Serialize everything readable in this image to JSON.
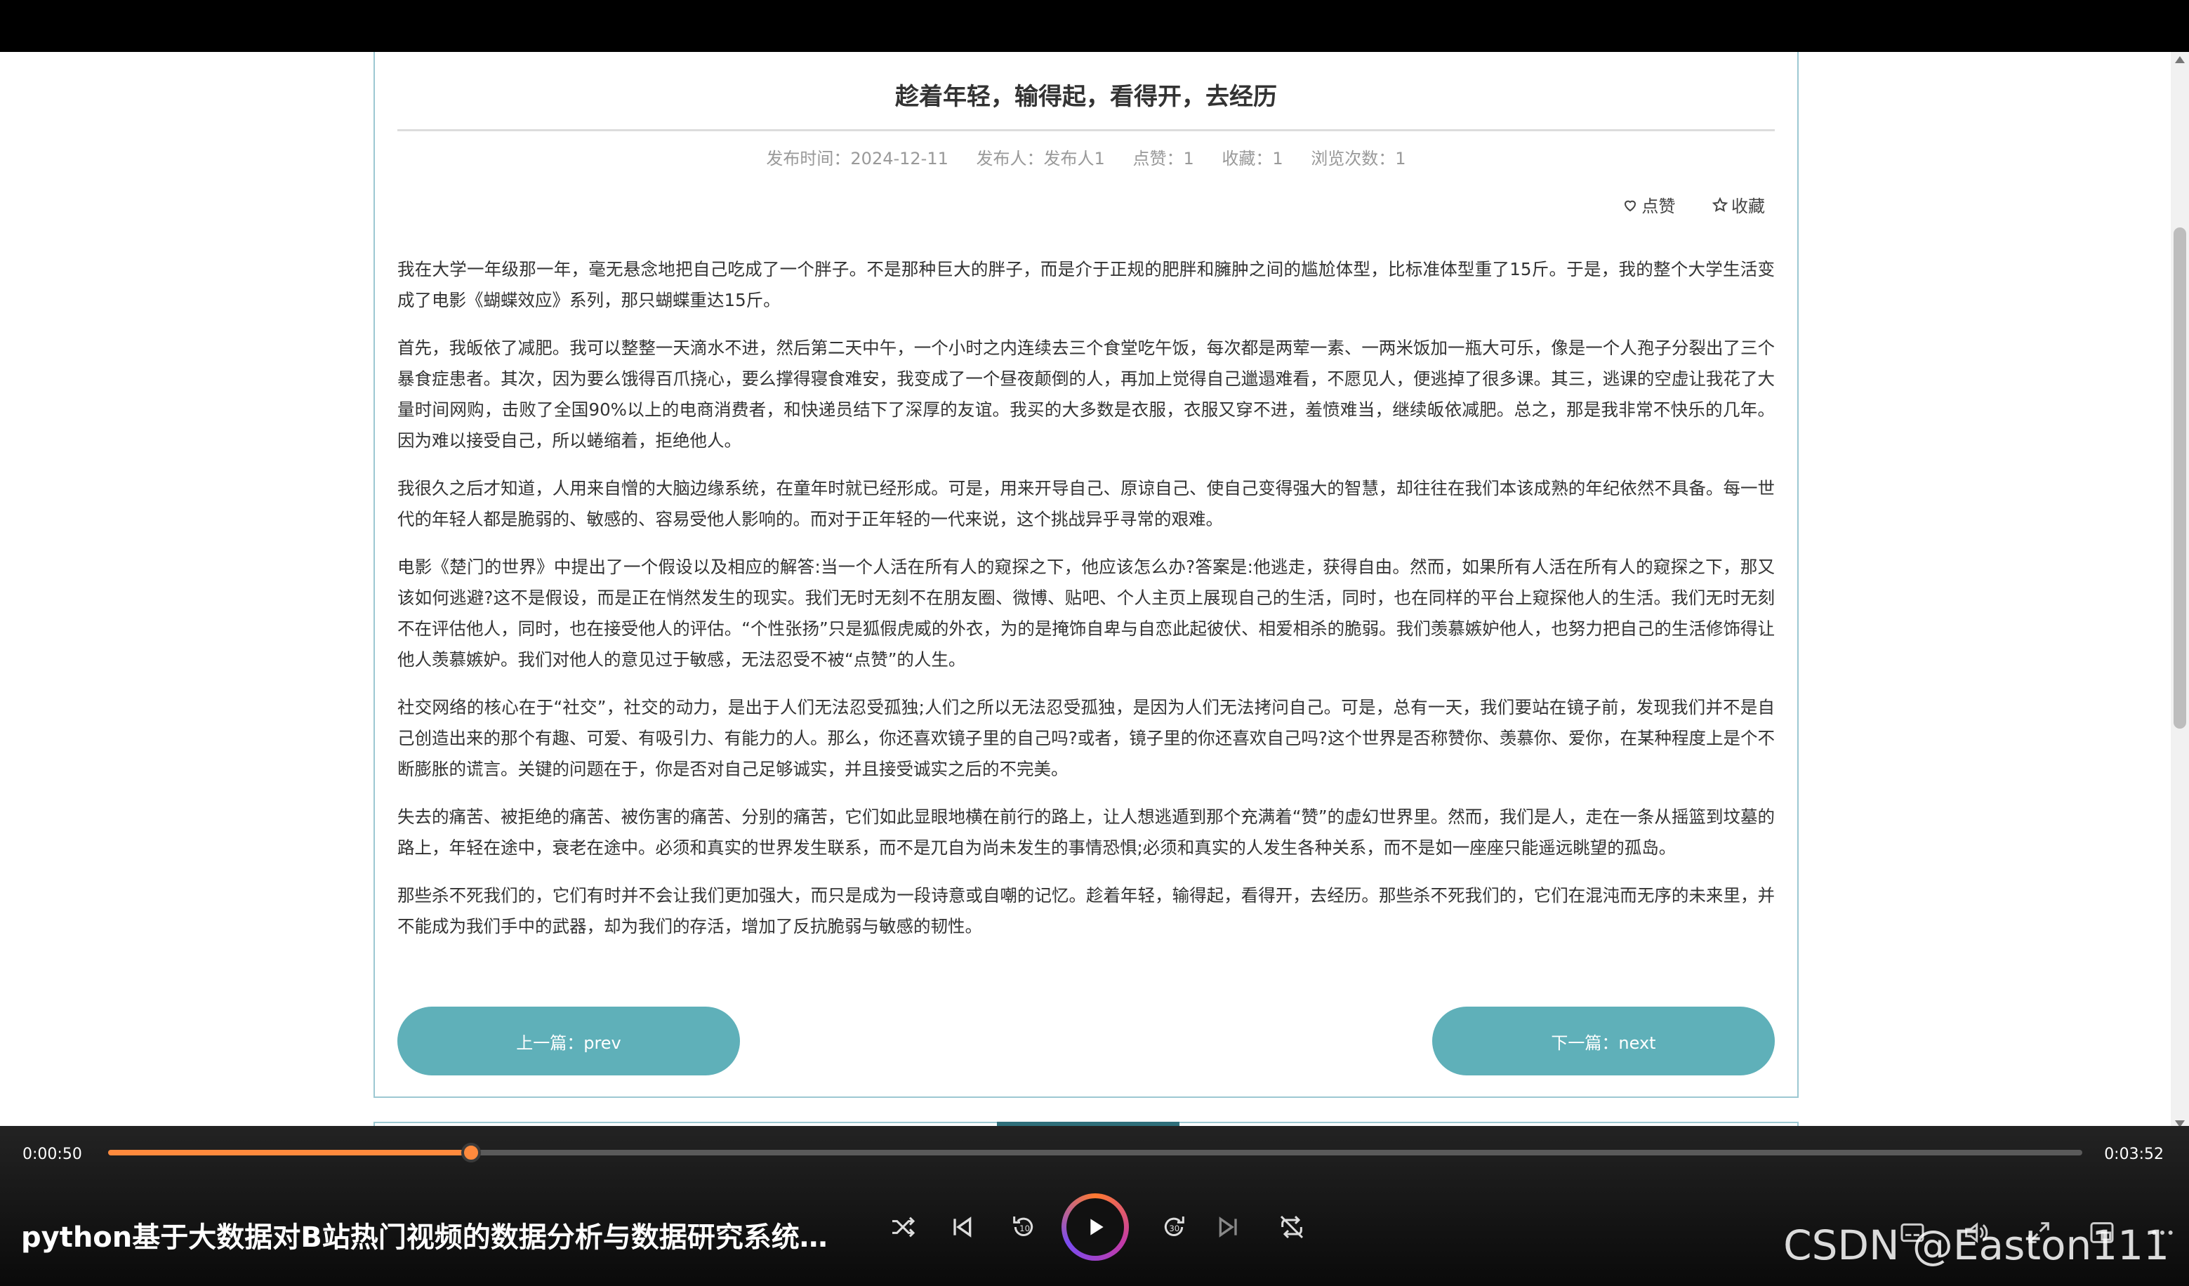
{
  "article": {
    "title": "趁着年轻，输得起，看得开，去经历",
    "meta": {
      "publish_time": "发布时间：2024-12-11",
      "publisher": "发布人：发布人1",
      "likes": "点赞：1",
      "favorites": "收藏：1",
      "views": "浏览次数：1"
    },
    "actions": {
      "like_label": "点赞",
      "favorite_label": "收藏"
    },
    "paragraphs": [
      "我在大学一年级那一年，毫无悬念地把自己吃成了一个胖子。不是那种巨大的胖子，而是介于正规的肥胖和臃肿之间的尴尬体型，比标准体型重了15斤。于是，我的整个大学生活变成了电影《蝴蝶效应》系列，那只蝴蝶重达15斤。",
      "首先，我皈依了减肥。我可以整整一天滴水不进，然后第二天中午，一个小时之内连续去三个食堂吃午饭，每次都是两荤一素、一两米饭加一瓶大可乐，像是一个人孢子分裂出了三个暴食症患者。其次，因为要么饿得百爪挠心，要么撑得寝食难安，我变成了一个昼夜颠倒的人，再加上觉得自己邋遢难看，不愿见人，便逃掉了很多课。其三，逃课的空虚让我花了大量时间网购，击败了全国90%以上的电商消费者，和快递员结下了深厚的友谊。我买的大多数是衣服，衣服又穿不进，羞愤难当，继续皈依减肥。总之，那是我非常不快乐的几年。因为难以接受自己，所以蜷缩着，拒绝他人。",
      "我很久之后才知道，人用来自憎的大脑边缘系统，在童年时就已经形成。可是，用来开导自己、原谅自己、使自己变得强大的智慧，却往往在我们本该成熟的年纪依然不具备。每一世代的年轻人都是脆弱的、敏感的、容易受他人影响的。而对于正年轻的一代来说，这个挑战异乎寻常的艰难。",
      "电影《楚门的世界》中提出了一个假设以及相应的解答:当一个人活在所有人的窥探之下，他应该怎么办?答案是:他逃走，获得自由。然而，如果所有人活在所有人的窥探之下，那又该如何逃避?这不是假设，而是正在悄然发生的现实。我们无时无刻不在朋友圈、微博、贴吧、个人主页上展现自己的生活，同时，也在同样的平台上窥探他人的生活。我们无时无刻不在评估他人，同时，也在接受他人的评估。“个性张扬”只是狐假虎威的外衣，为的是掩饰自卑与自恋此起彼伏、相爱相杀的脆弱。我们羡慕嫉妒他人，也努力把自己的生活修饰得让他人羡慕嫉妒。我们对他人的意见过于敏感，无法忍受不被“点赞”的人生。",
      "社交网络的核心在于“社交”，社交的动力，是出于人们无法忍受孤独;人们之所以无法忍受孤独，是因为人们无法拷问自己。可是，总有一天，我们要站在镜子前，发现我们并不是自己创造出来的那个有趣、可爱、有吸引力、有能力的人。那么，你还喜欢镜子里的自己吗?或者，镜子里的你还喜欢自己吗?这个世界是否称赞你、羡慕你、爱你，在某种程度上是个不断膨胀的谎言。关键的问题在于，你是否对自己足够诚实，并且接受诚实之后的不完美。",
      "失去的痛苦、被拒绝的痛苦、被伤害的痛苦、分别的痛苦，它们如此显眼地横在前行的路上，让人想逃遁到那个充满着“赞”的虚幻世界里。然而，我们是人，走在一条从摇篮到坟墓的路上，年轻在途中，衰老在途中。必须和真实的世界发生联系，而不是兀自为尚未发生的事情恐惧;必须和真实的人发生各种关系，而不是如一座座只能遥远眺望的孤岛。",
      "那些杀不死我们的，它们有时并不会让我们更加强大，而只是成为一段诗意或自嘲的记忆。趁着年轻，输得起，看得开，去经历。那些杀不死我们的，它们在混沌而无序的未来里，并不能成为我们手中的武器，却为我们的存活，增加了反抗脆弱与敏感的韧性。"
    ],
    "prev_label": "上一篇：prev",
    "next_label": "下一篇：next"
  },
  "player": {
    "current_time": "0:00:50",
    "total_time": "0:03:52",
    "progress": 0.184,
    "video_title": "python基于大数据对B站热门视频的数据分析与数据研究系统演...",
    "accent_color": "#ff8a3d",
    "controls": [
      "shuffle-icon",
      "skip-previous-icon",
      "rewind-10-icon",
      "play-icon",
      "forward-30-icon",
      "skip-next-icon",
      "repeat-off-icon"
    ],
    "right_controls": [
      "subtitles-icon",
      "volume-icon",
      "fullscreen-icon",
      "mini-player-icon",
      "more-icon"
    ]
  },
  "watermark": "CSDN @Easton111"
}
